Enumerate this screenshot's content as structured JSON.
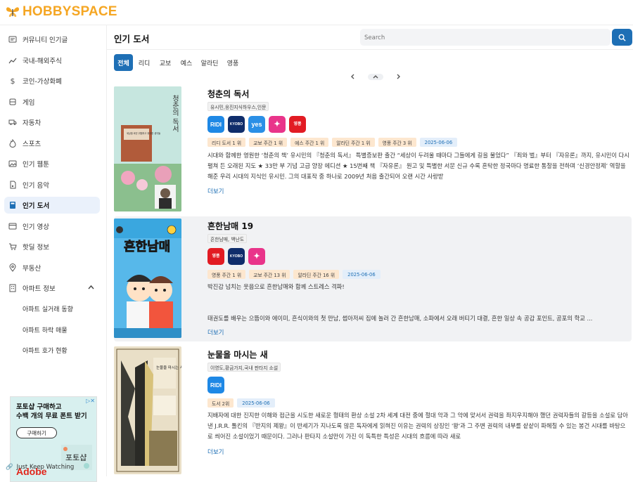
{
  "app": {
    "logo_text": "HOBBYSPACE"
  },
  "sidebar": {
    "items": [
      {
        "label": "커뮤니티 인기글",
        "icon": "newspaper-icon"
      },
      {
        "label": "국내-해외주식",
        "icon": "chart-line-icon"
      },
      {
        "label": "코인-가상화폐",
        "icon": "dollar-icon"
      },
      {
        "label": "게임",
        "icon": "gamepad-icon"
      },
      {
        "label": "자동차",
        "icon": "truck-icon"
      },
      {
        "label": "스포츠",
        "icon": "flame-icon"
      },
      {
        "label": "인기 웹툰",
        "icon": "image-icon"
      },
      {
        "label": "인기 음악",
        "icon": "music-file-icon"
      },
      {
        "label": "인기 도서",
        "icon": "book-icon"
      },
      {
        "label": "인기 영상",
        "icon": "video-icon"
      },
      {
        "label": "핫딜 정보",
        "icon": "cart-icon"
      },
      {
        "label": "부동산",
        "icon": "map-pin-icon"
      },
      {
        "label": "아파트 정보",
        "icon": "building-icon"
      }
    ],
    "active_index": 8,
    "sub_items": [
      "아파트 실거래 동향",
      "아파트 하락 매물",
      "아파트 호가 현황"
    ],
    "ad": {
      "title_line1": "포토샵 구매하고",
      "title_line2": "수백 개의 무료 폰트 받기",
      "button": "구매하기",
      "brand": "Adobe",
      "art_text": "포토샵"
    },
    "footer_link": "Just Keep Watching"
  },
  "main": {
    "title": "인기 도서",
    "search": {
      "placeholder": "Search",
      "value": ""
    },
    "tabs": [
      "전체",
      "리디",
      "교보",
      "예스",
      "알라딘",
      "영풍"
    ],
    "active_tab": 0
  },
  "books": [
    {
      "title": "청춘의 독서",
      "publisher": "유시민,웅진지식하우스,인문",
      "stores": [
        "RIDI",
        "KYOBO",
        "yes24",
        "aladin",
        "영풍문고"
      ],
      "ranks": [
        "리디 도서 1 위",
        "교보 주간 1 위",
        "예스 주간 1 위",
        "알라딘 주간 1 위",
        "영풍 주간 3 위"
      ],
      "date": "2025-06-06",
      "description": "시대와 함께한 영원한 ‘청춘의 책’ 유시민의 『청춘의 독서』 특별증보판 출간 “세상이 두려울 때마다 그들에게 길을 물었다” 『죄와 벌』부터 『자유론』까지, 유시민이 다시 펼쳐 든 오래된 지도 ★ 33만 부 기념 고급 양장 에디션 ★ 15번째 책 『자유론』 원고 및 특별한 서문 신규 수록 혼탁한 정국마다 명료한 통찰을 전하며 ‘신경안정제’ 역할을 해준 우리 시대의 지식인 유시민. 그의 대표작 중 하나로 2009년 처음 출간되어 오랜 시간 사랑받",
      "more": "더보기",
      "cover_title": "청춘의 독서",
      "cover_note": "세상을 바꾼 위험하고 위대한 생각들"
    },
    {
      "title": "흔한남매 19",
      "publisher": "흔한남매, 백난도",
      "stores": [
        "영풍문고",
        "KYOBO",
        "aladin"
      ],
      "ranks": [
        "영풍 주간 1 위",
        "교보 주간 13 위",
        "알라딘 주간 16 위"
      ],
      "date": "2025-06-06",
      "description": "박진감 넘치는 웃음으로 흔한남매와 함께 스트레스 격파!",
      "description2": "태권도를 배우는 으뜸이와 에이미, 흔식이와의 첫 만남, 썹아저씨 집에 놀러 간 흔한남매, 소파에서 오래 버티기 대결, 흔한 일상 속 공감 포인트, 공포의 학교 ...",
      "more": "더보기",
      "cover_title": "흔한남매"
    },
    {
      "title": "눈물을 마시는 새",
      "publisher": "이영도,황금가지,국내 판타지 소설",
      "stores": [
        "RIDI"
      ],
      "ranks": [
        "도서 2위"
      ],
      "date": "2025-06-06",
      "description": "지배자에 대한 진지한 이해와 접근을 시도한 새로운 형태의 환상 소설 2차 세계 대전 중에 절대 악과 그 악에 맞서서 권력을 좌지우지해야 했던 권력자들의 갈등을 소설로 담아낸 J.R.R. 톨킨의 『반지의 제왕』이 반세기가 지나도록 많은 독자에게 읽혀진 이유는 권력의 상징인 '왕'과 그 주변 권력의 내부를 샅샅이 파헤칠 수 있는 봉건 시대를 바탕으로 씌어진 소설이었기 때문이다. 그러나 판타지 소설만이 가진 이 독특한 특성은 시대의 흐름에 따라 새로",
      "more": "더보기",
      "cover_title": "눈물을 마시는 새"
    }
  ],
  "colors": {
    "accent": "#1e6fb5",
    "logo": "#f5a623",
    "rank_bg": "#fde7cf",
    "date_bg": "#e3eefa"
  }
}
